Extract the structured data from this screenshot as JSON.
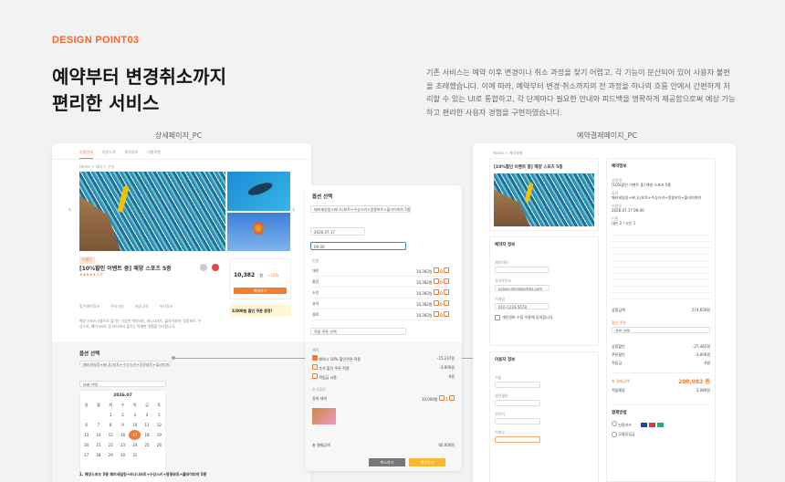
{
  "header": {
    "label": "DESIGN POINT03",
    "title_l1": "예약부터 변경취소까지",
    "title_l2": "편리한 서비스",
    "desc": "기존 서비스는 예약 이후 변경이나 취소 과정을 찾기 어렵고, 각 기능이 분산되어 있어 사용자 불편을 초래했습니다. 이에 따라, 예약부터 변경·취소까지의 전 과정을 하나의 흐름 안에서 간편하게 처리할 수 있는 UI로 통합하고, 각 단계마다 필요한 안내와 피드백을 명확하게 제공함으로써 예상 가능하고 편리한 사용자 경험을 구현하였습니다."
  },
  "captions": {
    "detail": "상세페이지_PC",
    "payment": "예약결제페이지_PC"
  },
  "detail": {
    "tabs": [
      "상품안내",
      "이용소개",
      "예약정보",
      "이용약관",
      "이용후기"
    ],
    "breadcrumb": "Home > 레저 > 수상",
    "badge": "이벤트",
    "product_title": "[10%할인 이벤트 중] 해양 스포츠 5종",
    "rating": "★★★★★ 4.9",
    "price": "10,382",
    "price_unit": "원",
    "discount": "~10%",
    "book_btn": "예약하기",
    "coupon": "3,000원 할인 쿠폰 증정!",
    "menu": [
      "할인혜택정보",
      "주의사항",
      "제공내역",
      "위치정보",
      "리뷰보기"
    ],
    "body_text": "해양 스포츠 5종으로 즐기는 다양한 액티비티. 바나나보트, 플라이피쉬, 땅콩보트, 수상스키, 웨이크보드 등 바다에서 즐기는 특별한 경험을 선사합니다.",
    "option_title": "옵션 선택",
    "option_value": "패러세일링+바나나보트+수상스키+땅콩보트+플라이피쉬 5종",
    "date_field": "날짜 선택",
    "cal_month": "2026.07",
    "weekdays": [
      "일",
      "월",
      "화",
      "수",
      "목",
      "금",
      "토"
    ],
    "days": [
      "",
      "",
      "1",
      "2",
      "3",
      "4",
      "5",
      "6",
      "7",
      "8",
      "9",
      "10",
      "11",
      "12",
      "13",
      "14",
      "15",
      "16",
      "17",
      "18",
      "19",
      "20",
      "21",
      "22",
      "23",
      "24",
      "25",
      "26",
      "27",
      "28",
      "29",
      "30",
      "31",
      "",
      ""
    ],
    "selected_day": "17",
    "footer_title": "1. 해양스포츠 5종 패러세일링+바나나보트+수상스키+땅콩보트+플라이피쉬 5종"
  },
  "option": {
    "title": "옵션 선택",
    "option_value": "패러세일링+바나나보트+수상스키+땅콩보트+플라이피쉬 5종",
    "date": "2026.07.17",
    "time": "09:00",
    "section_label": "인원",
    "rows": [
      {
        "name": "대인",
        "price": "10,382원",
        "qty": "0"
      },
      {
        "name": "중인",
        "price": "10,382원",
        "qty": "0"
      },
      {
        "name": "소인",
        "price": "10,382원",
        "qty": "0"
      },
      {
        "name": "유아",
        "price": "10,382원",
        "qty": "0"
      },
      {
        "name": "경로",
        "price": "10,382원",
        "qty": "0"
      }
    ],
    "coupon_select": "적용 쿠폰 선택",
    "benefit_label": "혜택",
    "benefits": [
      {
        "name": "예약시 10% 할인쿠폰 적용",
        "price": "-15,237원"
      },
      {
        "name": "추가 할인 쿠폰 적용",
        "price": "-3,000원"
      },
      {
        "name": "적립금 사용",
        "price": "-0원"
      }
    ],
    "extra_label": "추가옵션",
    "extra_item": "장비 대여",
    "extra_price": "10,000원",
    "extra_qty": "1",
    "total_label": "총 결제금액",
    "total_price": "40,000원",
    "cancel_btn": "취소하기",
    "confirm_btn": "예약하기"
  },
  "payment": {
    "breadcrumb": "Home > 예약결제",
    "product_title": "[10%할인 이벤트 중] 해양 스포츠 5종",
    "section_booker": "예약자 정보",
    "booker_fields": [
      "예약자명",
      "휴대폰번호",
      "이메일"
    ],
    "email": "ocean.stm@korhes.com",
    "phone": "010-1234-5678",
    "agree": "개인정보 수집 이용에 동의합니다.",
    "section_user": "이용자 정보",
    "user_fields": [
      "이름",
      "생년월일",
      "연락처",
      "이메일"
    ],
    "summary_title": "예약정보",
    "summary_rows": [
      {
        "k": "상품명",
        "v": "[10%할인 이벤트 중] 해양 스포츠 5종"
      },
      {
        "k": "옵션",
        "v": "패러세일링+바나나보트+수상스키+땅콩보트+플라이피쉬"
      },
      {
        "k": "이용일",
        "v": "2026.07.17 09:00"
      },
      {
        "k": "인원",
        "v": "대인 2 / 소인 1"
      }
    ],
    "price_label": "상품금액",
    "price": "274,650원",
    "coupon_label": "할인 쿠폰",
    "coupon_value": "쿠폰 선택",
    "discount_rows": [
      {
        "k": "상품할인",
        "v": "-27,465원"
      },
      {
        "k": "쿠폰할인",
        "v": "-3,000원"
      },
      {
        "k": "적립금",
        "v": "-0원"
      }
    ],
    "total_label": "총 결제금액",
    "total": "208,082 원",
    "point_label": "적립예정",
    "point": "2,080원",
    "method_title": "결제방법",
    "methods": [
      "신용카드",
      "무통장입금"
    ]
  }
}
